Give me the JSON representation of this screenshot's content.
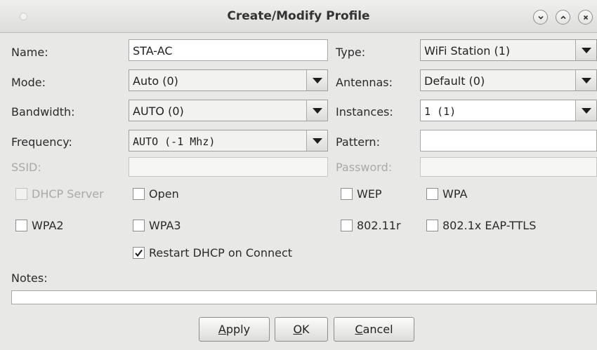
{
  "window": {
    "title": "Create/Modify Profile"
  },
  "form": {
    "name_label": "Name:",
    "name_value": "STA-AC",
    "type_label": "Type:",
    "type_value": "WiFi Station (1)",
    "mode_label": "Mode:",
    "mode_value": "Auto (0)",
    "antennas_label": "Antennas:",
    "antennas_value": "Default (0)",
    "bandwidth_label": "Bandwidth:",
    "bandwidth_value": "AUTO (0)",
    "instances_label": "Instances:",
    "instances_value": "1 (1)",
    "frequency_label": "Frequency:",
    "frequency_value": "AUTO (-1 Mhz)",
    "pattern_label": "Pattern:",
    "pattern_value": "",
    "ssid_label": "SSID:",
    "ssid_value": "",
    "password_label": "Password:",
    "password_value": "",
    "notes_label": "Notes:",
    "notes_value": ""
  },
  "checkboxes": {
    "dhcp_server": {
      "label": "DHCP Server",
      "checked": false,
      "enabled": false
    },
    "open": {
      "label": "Open",
      "checked": false,
      "enabled": true
    },
    "wep": {
      "label": "WEP",
      "checked": false,
      "enabled": true
    },
    "wpa": {
      "label": "WPA",
      "checked": false,
      "enabled": true
    },
    "wpa2": {
      "label": "WPA2",
      "checked": false,
      "enabled": true
    },
    "wpa3": {
      "label": "WPA3",
      "checked": false,
      "enabled": true
    },
    "r80211": {
      "label": "802.11r",
      "checked": false,
      "enabled": true
    },
    "eap_ttls": {
      "label": "802.1x EAP-TTLS",
      "checked": false,
      "enabled": true
    },
    "restart_dhcp": {
      "label": "Restart DHCP on Connect",
      "checked": true,
      "enabled": true
    }
  },
  "buttons": {
    "apply": {
      "mnemonic": "A",
      "rest": "pply"
    },
    "ok": {
      "mnemonic": "O",
      "rest": "K"
    },
    "cancel": {
      "mnemonic": "C",
      "rest": "ancel"
    }
  },
  "icons": {
    "minimize": "chevron-down-icon",
    "maximize": "chevron-up-icon",
    "close": "close-icon"
  }
}
